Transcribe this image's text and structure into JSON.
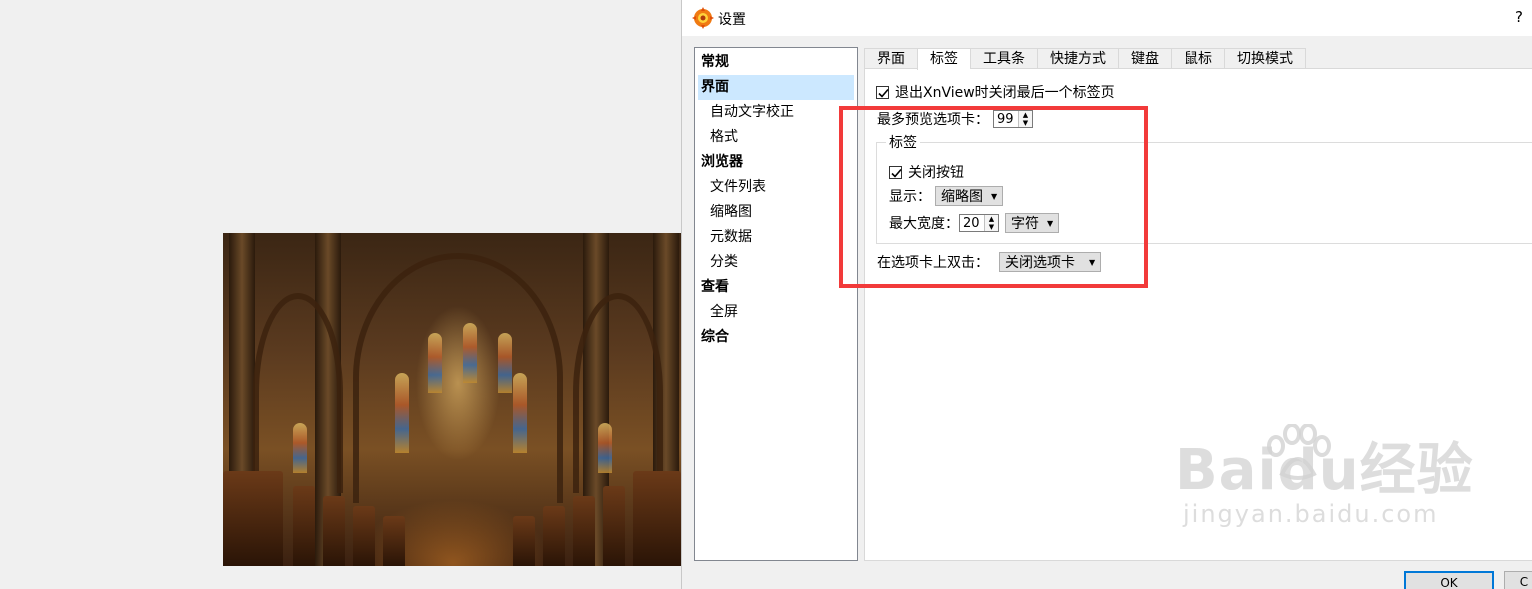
{
  "dialog": {
    "title": "设置",
    "help": "?"
  },
  "nav": [
    {
      "label": "常规",
      "level": 0
    },
    {
      "label": "界面",
      "level": 0,
      "selected": true
    },
    {
      "label": "自动文字校正",
      "level": 1
    },
    {
      "label": "格式",
      "level": 1
    },
    {
      "label": "浏览器",
      "level": 0
    },
    {
      "label": "文件列表",
      "level": 1
    },
    {
      "label": "缩略图",
      "level": 1
    },
    {
      "label": "元数据",
      "level": 1
    },
    {
      "label": "分类",
      "level": 1
    },
    {
      "label": "查看",
      "level": 0
    },
    {
      "label": "全屏",
      "level": 1
    },
    {
      "label": "综合",
      "level": 0
    }
  ],
  "tabs": [
    "界面",
    "标签",
    "工具条",
    "快捷方式",
    "键盘",
    "鼠标",
    "切换模式"
  ],
  "active_tab": "标签",
  "settings": {
    "close_last_tab": {
      "label": "退出XnView时关闭最后一个标签页",
      "checked": true
    },
    "max_preview_tabs": {
      "label": "最多预览选项卡：",
      "value": "99"
    },
    "group_label": "标签",
    "close_button": {
      "label": "关闭按钮",
      "checked": true
    },
    "display": {
      "label": "显示：",
      "value": "缩略图"
    },
    "max_width": {
      "label": "最大宽度：",
      "value": "20",
      "unit": "字符"
    },
    "double_click": {
      "label": "在选项卡上双击：",
      "value": "关闭选项卡"
    }
  },
  "buttons": {
    "ok": "OK",
    "cancel": "C"
  },
  "watermark": {
    "main": "Baidu经验",
    "sub": "jingyan.baidu.com"
  },
  "colors": {
    "highlight": "#f23a3a",
    "selection": "#cce8ff",
    "ok_border": "#0078d7"
  }
}
